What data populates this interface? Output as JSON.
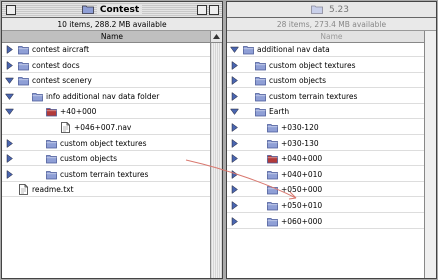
{
  "left_window": {
    "title": "Contest",
    "info": "10 items, 288.2 MB available",
    "column_header": "Name",
    "rows": [
      {
        "label": "contest aircraft",
        "indent": 0,
        "expanded": false,
        "icon": "folder-icon"
      },
      {
        "label": "contest docs",
        "indent": 0,
        "expanded": false,
        "icon": "folder-icon"
      },
      {
        "label": "contest scenery",
        "indent": 0,
        "expanded": true,
        "icon": "folder-icon"
      },
      {
        "label": "info additional nav data folder",
        "indent": 1,
        "expanded": true,
        "icon": "folder-icon"
      },
      {
        "label": "+40+000",
        "indent": 2,
        "expanded": true,
        "icon": "red-folder-icon"
      },
      {
        "label": "+046+007.nav",
        "indent": 3,
        "expanded": null,
        "icon": "document-icon"
      },
      {
        "label": "custom object textures",
        "indent": 2,
        "expanded": false,
        "icon": "folder-icon"
      },
      {
        "label": "custom objects",
        "indent": 2,
        "expanded": false,
        "icon": "folder-icon"
      },
      {
        "label": "custom terrain textures",
        "indent": 2,
        "expanded": false,
        "icon": "folder-icon"
      },
      {
        "label": "readme.txt",
        "indent": 0,
        "expanded": null,
        "icon": "document-icon"
      }
    ]
  },
  "right_window": {
    "title": "5.23",
    "info": "28 items, 273.4 MB available",
    "column_header": "Name",
    "rows": [
      {
        "label": "additional nav data",
        "indent": 0,
        "expanded": true,
        "icon": "folder-icon"
      },
      {
        "label": "custom object textures",
        "indent": 1,
        "expanded": false,
        "icon": "folder-icon"
      },
      {
        "label": "custom objects",
        "indent": 1,
        "expanded": false,
        "icon": "folder-icon"
      },
      {
        "label": "custom terrain textures",
        "indent": 1,
        "expanded": false,
        "icon": "folder-icon"
      },
      {
        "label": "Earth",
        "indent": 1,
        "expanded": true,
        "icon": "folder-icon"
      },
      {
        "label": "+030-120",
        "indent": 2,
        "expanded": false,
        "icon": "folder-icon"
      },
      {
        "label": "+030-130",
        "indent": 2,
        "expanded": false,
        "icon": "folder-icon"
      },
      {
        "label": "+040+000",
        "indent": 2,
        "expanded": false,
        "icon": "red-folder-icon"
      },
      {
        "label": "+040+010",
        "indent": 2,
        "expanded": false,
        "icon": "folder-icon"
      },
      {
        "label": "+050+000",
        "indent": 2,
        "expanded": false,
        "icon": "folder-icon"
      },
      {
        "label": "+050+010",
        "indent": 2,
        "expanded": false,
        "icon": "folder-icon"
      },
      {
        "label": "+060+000",
        "indent": 2,
        "expanded": false,
        "icon": "folder-icon"
      }
    ]
  },
  "colors": {
    "folder": "#8f9fd6",
    "folder_dark": "#4a5a98",
    "red_folder": "#b23a3a",
    "drag_line": "#d9786f",
    "triangle": "#4a66b0"
  }
}
